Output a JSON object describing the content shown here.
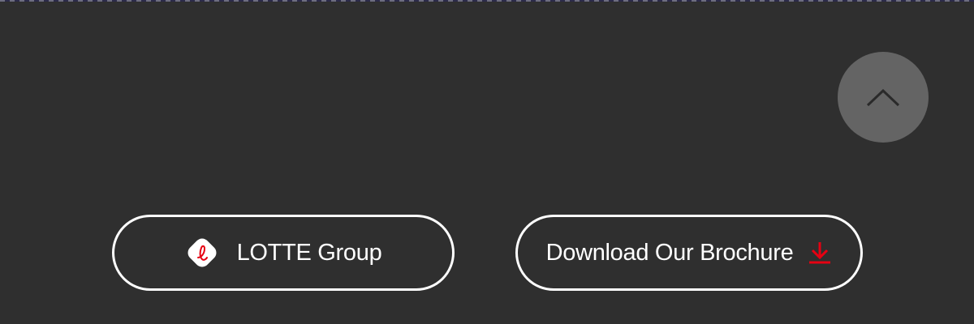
{
  "footer": {
    "lotte_button": {
      "label": "LOTTE Group",
      "icon": "lotte-logo-icon"
    },
    "brochure_button": {
      "label": "Download Our Brochure",
      "icon": "download-icon"
    },
    "scroll_top": {
      "icon": "chevron-up-icon"
    }
  },
  "colors": {
    "background": "#2f2f2f",
    "scroll_top_bg": "#646464",
    "accent_red": "#e60012",
    "text": "#ffffff"
  }
}
